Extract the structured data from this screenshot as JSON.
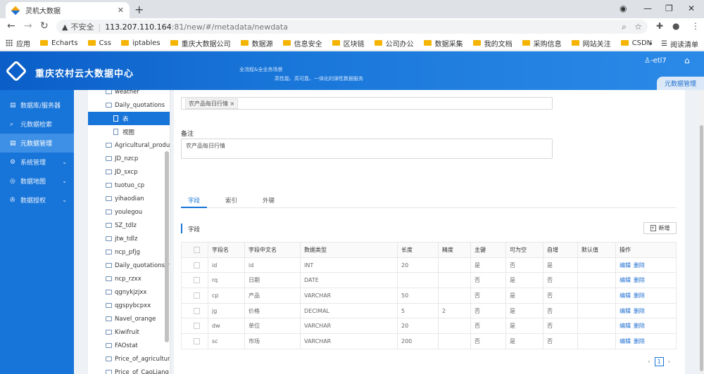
{
  "browser": {
    "tab_title": "灵机大数据",
    "insecure_label": "不安全",
    "url_host": "113.207.110.164",
    "url_rest": ":81/new/#/metadata/newdata",
    "bookmarks": [
      "应用",
      "Echarts",
      "Css",
      "iptables",
      "重庆大数据公司",
      "数据源",
      "信息安全",
      "区块链",
      "公司办公",
      "数据采集",
      "我的文档",
      "采购信息",
      "网站关注",
      "CSDN"
    ],
    "more": "»",
    "reading_list": "阅读清单"
  },
  "header": {
    "brand": "重庆农村云大数据中心",
    "slogan1": "全流程&全业务场景",
    "slogan2": "高性能、高可靠、一体化的弹性数据服务",
    "user": "-etl7",
    "crumb": "元数据管理"
  },
  "sidebar": {
    "items": [
      {
        "icon": "▤",
        "label": "数据库/服务器",
        "chev": ""
      },
      {
        "icon": "⌕",
        "label": "元数据检索",
        "chev": ""
      },
      {
        "icon": "▤",
        "label": "元数据管理",
        "chev": ""
      },
      {
        "icon": "⚙",
        "label": "系统管理",
        "chev": "⌄"
      },
      {
        "icon": "◎",
        "label": "数据地图",
        "chev": "⌄"
      },
      {
        "icon": "✇",
        "label": "数据授权",
        "chev": "⌄"
      }
    ]
  },
  "tree": {
    "nodes": [
      {
        "label": "weather",
        "type": "folder",
        "level": "top"
      },
      {
        "label": "Daily_quotations",
        "type": "folder",
        "level": "top"
      },
      {
        "label": "表",
        "type": "doc",
        "level": "child"
      },
      {
        "label": "视图",
        "type": "doc",
        "level": "child"
      },
      {
        "label": "Agricultural_produ",
        "type": "folder",
        "level": "top"
      },
      {
        "label": "JD_nzcp",
        "type": "folder",
        "level": "top"
      },
      {
        "label": "JD_sxcp",
        "type": "folder",
        "level": "top"
      },
      {
        "label": "tuotuo_cp",
        "type": "folder",
        "level": "top"
      },
      {
        "label": "yihaodian",
        "type": "folder",
        "level": "top"
      },
      {
        "label": "youlegou",
        "type": "folder",
        "level": "top"
      },
      {
        "label": "SZ_tdlz",
        "type": "folder",
        "level": "top"
      },
      {
        "label": "jtw_tdlz",
        "type": "folder",
        "level": "top"
      },
      {
        "label": "ncp_pfjg",
        "type": "folder",
        "level": "top"
      },
      {
        "label": "Daily_quotations_rc",
        "type": "folder",
        "level": "top"
      },
      {
        "label": "ncp_rzxx",
        "type": "folder",
        "level": "top"
      },
      {
        "label": "qgnykjzjxx",
        "type": "folder",
        "level": "top"
      },
      {
        "label": "qgspybcpxx",
        "type": "folder",
        "level": "top"
      },
      {
        "label": "Navel_orange",
        "type": "folder",
        "level": "top"
      },
      {
        "label": "Kiwifruit",
        "type": "folder",
        "level": "top"
      },
      {
        "label": "FAOstat",
        "type": "folder",
        "level": "top"
      },
      {
        "label": "Price_of_agricultur",
        "type": "folder",
        "level": "top"
      },
      {
        "label": "Price_of_CaoLiang",
        "type": "folder",
        "level": "top"
      }
    ]
  },
  "form": {
    "tag": "农产品每日行情",
    "tag_close": "×",
    "note_label": "备注",
    "note_value": "农产品每日行情"
  },
  "tabs": [
    "字段",
    "索引",
    "外键"
  ],
  "section": {
    "title": "字段",
    "add_label": "新增"
  },
  "table": {
    "headers": [
      "",
      "字段名",
      "字段中文名",
      "数据类型",
      "长度",
      "精度",
      "主键",
      "可为空",
      "自增",
      "默认值",
      "操作"
    ],
    "rows": [
      [
        "",
        "id",
        "id",
        "INT",
        "20",
        "",
        "是",
        "否",
        "是",
        "",
        ""
      ],
      [
        "",
        "rq",
        "日期",
        "DATE",
        "",
        "",
        "否",
        "是",
        "否",
        "",
        ""
      ],
      [
        "",
        "cp",
        "产品",
        "VARCHAR",
        "50",
        "",
        "否",
        "是",
        "否",
        "",
        ""
      ],
      [
        "",
        "jg",
        "价格",
        "DECIMAL",
        "5",
        "2",
        "否",
        "是",
        "否",
        "",
        ""
      ],
      [
        "",
        "dw",
        "单位",
        "VARCHAR",
        "20",
        "",
        "否",
        "是",
        "否",
        "",
        ""
      ],
      [
        "",
        "sc",
        "市场",
        "VARCHAR",
        "200",
        "",
        "否",
        "是",
        "否",
        "",
        ""
      ]
    ],
    "edit_label": "编辑",
    "delete_label": "删除"
  },
  "pager": {
    "prev": "‹",
    "page": "1",
    "next": "›"
  }
}
